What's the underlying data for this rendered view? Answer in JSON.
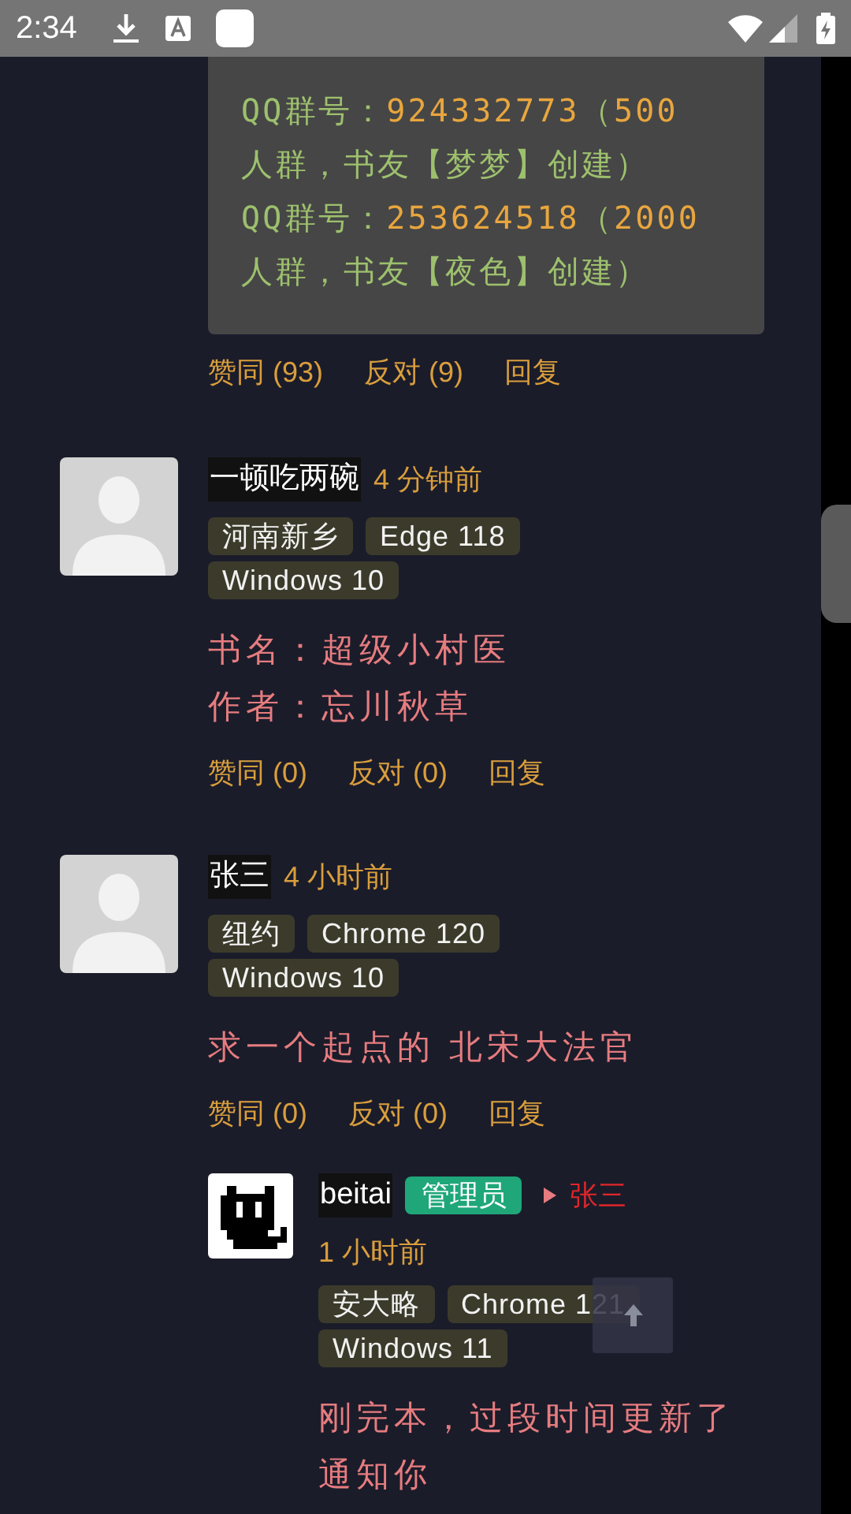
{
  "status_bar": {
    "time": "2:34"
  },
  "top_comment": {
    "paragraphs": [
      {
        "lines": [
          [
            {
              "text": "QQ群号：",
              "highlight": false
            },
            {
              "text": "924332773",
              "highlight": true
            },
            {
              "text": "（",
              "highlight": false
            },
            {
              "text": "500",
              "highlight": true
            }
          ],
          [
            {
              "text": "人群，书友【梦梦】创建）",
              "highlight": false
            }
          ]
        ]
      },
      {
        "lines": [
          [
            {
              "text": "QQ群号：",
              "highlight": false
            },
            {
              "text": "253624518",
              "highlight": true
            },
            {
              "text": "（",
              "highlight": false
            },
            {
              "text": "2000",
              "highlight": true
            }
          ],
          [
            {
              "text": "人群，书友【夜色】创建）",
              "highlight": false
            }
          ]
        ]
      }
    ],
    "actions": [
      "赞同 (93)",
      "反对 (9)",
      "回复"
    ]
  },
  "comments": [
    {
      "avatar": {
        "kind": "silhouette"
      },
      "user": "一顿吃两碗",
      "time": "4 分钟前",
      "tags": [
        "河南新乡",
        "Edge 118",
        "Windows 10"
      ],
      "body_lines": [
        "书名：超级小村医",
        "作者：忘川秋草"
      ],
      "actions": [
        "赞同 (0)",
        "反对 (0)",
        "回复"
      ]
    },
    {
      "avatar": {
        "kind": "silhouette"
      },
      "user": "张三",
      "time": "4 小时前",
      "tags": [
        "纽约",
        "Chrome 120",
        "Windows 10"
      ],
      "body_lines": [
        "求一个起点的 北宋大法官"
      ],
      "actions": [
        "赞同 (0)",
        "反对 (0)",
        "回复"
      ],
      "replies": [
        {
          "avatar": {
            "kind": "pixel-cat"
          },
          "user": "beitai",
          "role": "管理员",
          "reply_to": "张三",
          "time": "1 小时前",
          "tags": [
            "安大略",
            "Chrome 121",
            "Windows 11"
          ],
          "body_lines": [
            "刚完本，过段时间更新了",
            "通知你"
          ]
        }
      ]
    }
  ]
}
